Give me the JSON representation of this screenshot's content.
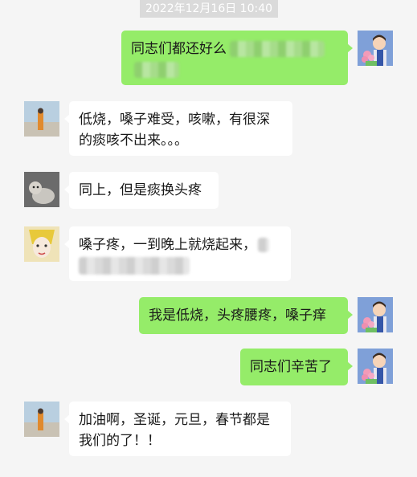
{
  "timestamp": "2022年12月16日 10:40",
  "messages": [
    {
      "sender": "me",
      "avatar_icon": "cartoon-person-with-flowers-avatar",
      "text": "同志们都还好么"
    },
    {
      "sender": "other",
      "avatar_icon": "beach-photo-avatar",
      "text": "低烧，嗓子难受，咳嗽，有很深的痰咳不出来。。。"
    },
    {
      "sender": "other",
      "avatar_icon": "cat-photo-avatar",
      "text": "同上，但是痰换头疼"
    },
    {
      "sender": "other",
      "avatar_icon": "anime-character-avatar",
      "text": "嗓子疼，一到晚上就烧起来，"
    },
    {
      "sender": "me",
      "avatar_icon": "cartoon-person-with-flowers-avatar",
      "text": "我是低烧，头疼腰疼，嗓子痒"
    },
    {
      "sender": "me",
      "avatar_icon": "cartoon-person-with-flowers-avatar",
      "text": "同志们辛苦了"
    },
    {
      "sender": "other",
      "avatar_icon": "beach-photo-avatar",
      "text": "加油啊，圣诞，元旦，春节都是我们的了！！"
    }
  ],
  "colors": {
    "my_bubble": "#95ec69",
    "other_bubble": "#ffffff",
    "background": "#f5f5f5"
  }
}
